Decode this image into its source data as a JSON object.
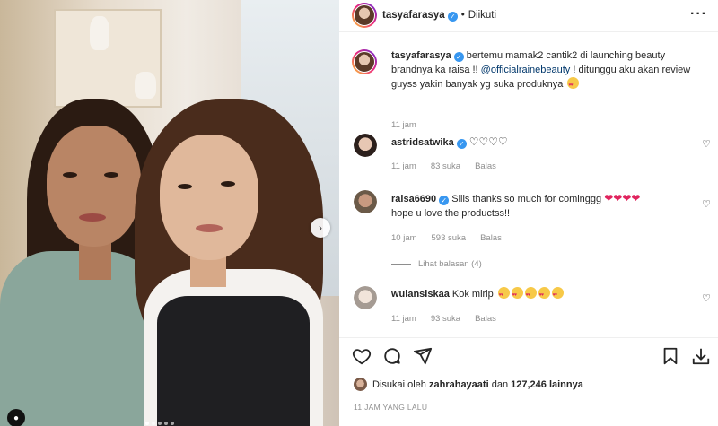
{
  "post": {
    "author": "tasyafarasya",
    "follow_status": "Diikuti",
    "bullet": "•"
  },
  "caption": {
    "username": "tasyafarasya",
    "text_before_link": "bertemu mamak2 cantik2 di launching beauty brandnya ka raisa !! ",
    "mention": "@officialrainebeauty",
    "text_after_link": " ! ditunggu aku akan review guyss yakin banyak yg suka produknya",
    "time": "11 jam"
  },
  "comments": [
    {
      "username": "astridsatwika",
      "text": "♡♡♡♡",
      "time": "11 jam",
      "likes": "83 suka",
      "reply": "Balas"
    },
    {
      "username": "raisa6690",
      "text_line1": "Siiis thanks so much for cominggg",
      "hearts": "❤❤❤❤",
      "text_line2": "hope u love the productss!!",
      "time": "10 jam",
      "likes": "593 suka",
      "reply": "Balas",
      "view_replies": "Lihat balasan (4)"
    },
    {
      "username": "wulansiskaa",
      "text": "Kok mirip",
      "time": "11 jam",
      "likes": "93 suka",
      "reply": "Balas"
    }
  ],
  "likes_line": {
    "prefix": "Disukai oleh",
    "user": "zahrahayaati",
    "middle": "dan",
    "count": "127,246 lainnya"
  },
  "post_time": "11 JAM YANG LALU",
  "icons": {
    "more": "more-options-icon",
    "like": "heart-icon",
    "comment": "comment-icon",
    "share": "share-icon",
    "save": "bookmark-icon",
    "download": "download-icon",
    "next": "chevron-right-icon",
    "tag": "user-tag-icon"
  },
  "colors": {
    "verified": "#3897f0",
    "link": "#00376b",
    "meta": "#8e8e8e",
    "heart_red": "#e0245e"
  }
}
